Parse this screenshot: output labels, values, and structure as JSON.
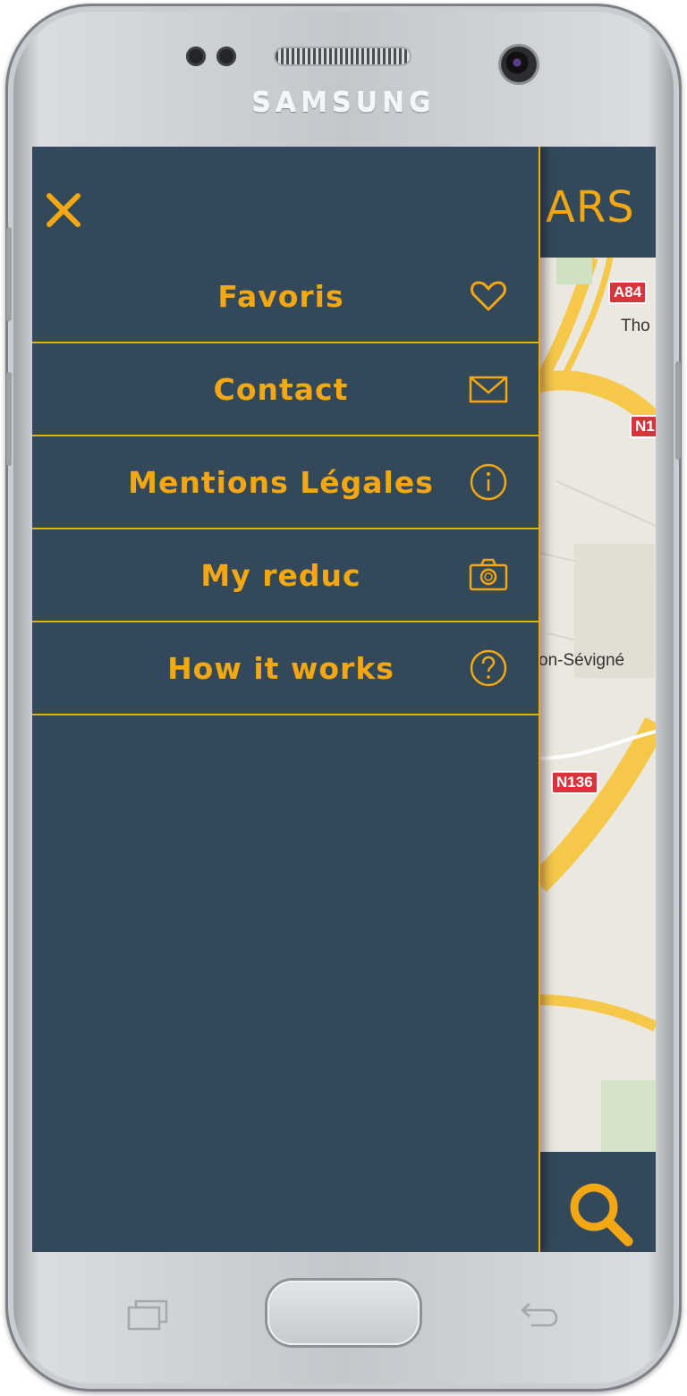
{
  "device": {
    "brand": "SAMSUNG"
  },
  "app": {
    "logo_visible_text": "ARS"
  },
  "drawer": {
    "menu": [
      {
        "label": "Favoris",
        "icon": "heart-icon"
      },
      {
        "label": "Contact",
        "icon": "mail-icon"
      },
      {
        "label": "Mentions Légales",
        "icon": "info-icon"
      },
      {
        "label": "My reduc",
        "icon": "camera-icon"
      },
      {
        "label": "How it works",
        "icon": "help-icon"
      }
    ]
  },
  "map": {
    "labels": [
      "Tho",
      "on-Sévigné"
    ],
    "road_badges": [
      "A84",
      "N1",
      "N136"
    ]
  },
  "colors": {
    "accent": "#f3a712",
    "panel": "#33495a",
    "map_bg": "#ebe8df",
    "road": "#f5c84a",
    "badge": "#d8343b"
  }
}
